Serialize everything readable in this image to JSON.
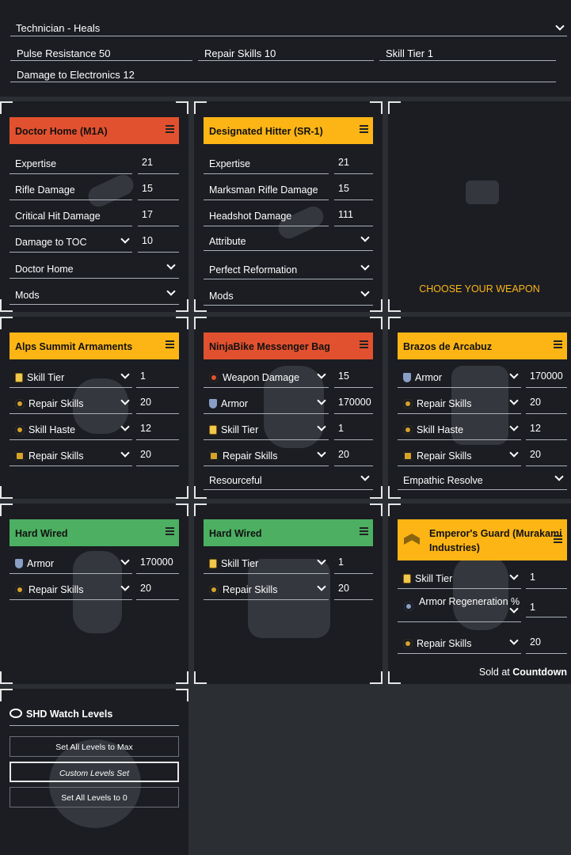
{
  "specialization": {
    "selected": "Technician - Heals"
  },
  "spec_stats": [
    "Pulse Resistance 50",
    "Repair Skills 10",
    "Skill Tier 1",
    "Damage to Electronics 12"
  ],
  "weapons": [
    {
      "name": "Doctor Home (M1A)",
      "stats": [
        {
          "label": "Expertise",
          "value": "21"
        },
        {
          "label": "Rifle Damage",
          "value": "15"
        },
        {
          "label": "Critical Hit Damage",
          "value": "17"
        },
        {
          "label": "Damage to TOC",
          "value": "10"
        }
      ],
      "talent": "Doctor Home",
      "mods": "Mods"
    },
    {
      "name": "Designated Hitter (SR-1)",
      "stats": [
        {
          "label": "Expertise",
          "value": "21"
        },
        {
          "label": "Marksman Rifle Damage",
          "value": "15"
        },
        {
          "label": "Headshot Damage",
          "value": "111"
        }
      ],
      "attribute": "Attribute",
      "talent": "Perfect Reformation",
      "mods": "Mods"
    },
    {
      "choose_label": "CHOOSE YOUR WEAPON"
    }
  ],
  "gear": [
    {
      "name": "Alps Summit Armaments",
      "attrs": [
        {
          "label": "Skill Tier",
          "value": "1"
        },
        {
          "label": "Repair Skills",
          "value": "20"
        },
        {
          "label": "Skill Haste",
          "value": "12"
        },
        {
          "label": "Repair Skills",
          "value": "20"
        }
      ]
    },
    {
      "name": "NinjaBike Messenger Bag",
      "attrs": [
        {
          "label": "Weapon Damage",
          "value": "15"
        },
        {
          "label": "Armor",
          "value": "170000"
        },
        {
          "label": "Skill Tier",
          "value": "1"
        },
        {
          "label": "Repair Skills",
          "value": "20"
        }
      ],
      "talent": "Resourceful"
    },
    {
      "name": "Brazos de Arcabuz",
      "attrs": [
        {
          "label": "Armor",
          "value": "170000"
        },
        {
          "label": "Repair Skills",
          "value": "20"
        },
        {
          "label": "Skill Haste",
          "value": "12"
        },
        {
          "label": "Repair Skills",
          "value": "20"
        }
      ],
      "talent": "Empathic Resolve"
    },
    {
      "name": "Hard Wired",
      "attrs": [
        {
          "label": "Armor",
          "value": "170000"
        },
        {
          "label": "Repair Skills",
          "value": "20"
        }
      ]
    },
    {
      "name": "Hard Wired",
      "attrs": [
        {
          "label": "Skill Tier",
          "value": "1"
        },
        {
          "label": "Repair Skills",
          "value": "20"
        }
      ]
    },
    {
      "name": "Emperor's Guard (Murakami Industries)",
      "attrs": [
        {
          "label": "Skill Tier",
          "value": "1"
        },
        {
          "label": "Armor Regeneration %",
          "value": "1"
        },
        {
          "label": "Repair Skills",
          "value": "20"
        }
      ]
    }
  ],
  "sold_at": {
    "prefix": "Sold at",
    "vendor": "Countdown"
  },
  "shd": {
    "title": "SHD Watch Levels",
    "max_label": "Set All Levels to Max",
    "custom_label": "Custom Levels Set",
    "zero_label": "Set All Levels to 0"
  },
  "colors": {
    "red": "#e2512f",
    "yellow": "#fdb515",
    "green": "#4caf62",
    "panel": "#1b1d22",
    "bg": "#2b2e33"
  }
}
